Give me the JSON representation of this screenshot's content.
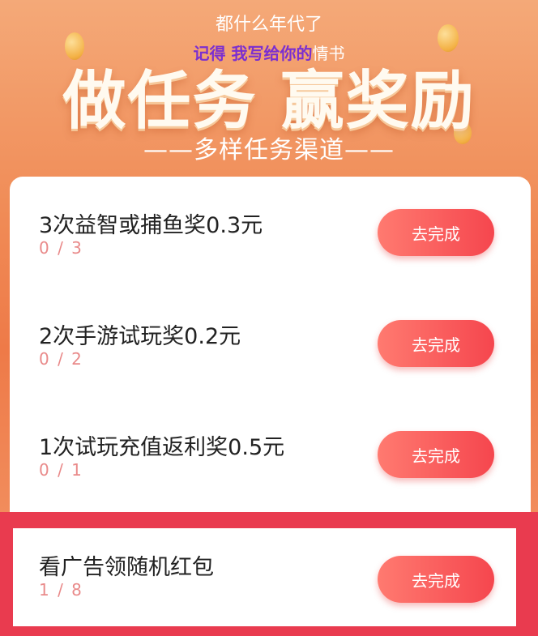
{
  "banner": {
    "lyric_line1": "都什么年代了",
    "lyric_line2_purple": "记得 我写给你的",
    "lyric_line2_white": "情书",
    "headline": "做任务 赢奖励",
    "subline": "——多样任务渠道——"
  },
  "tasks": [
    {
      "title": "3次益智或捕鱼奖0.3元",
      "progress": "0 / 3",
      "button": "去完成"
    },
    {
      "title": "2次手游试玩奖0.2元",
      "progress": "0 / 2",
      "button": "去完成"
    },
    {
      "title": "1次试玩充值返利奖0.5元",
      "progress": "0 / 1",
      "button": "去完成"
    },
    {
      "title": "看广告领随机红包",
      "progress": "1 / 8",
      "button": "去完成"
    }
  ],
  "colors": {
    "accent": "#f5464e",
    "highlight_border": "#e93b4f",
    "progress_text": "#e98a8a"
  }
}
